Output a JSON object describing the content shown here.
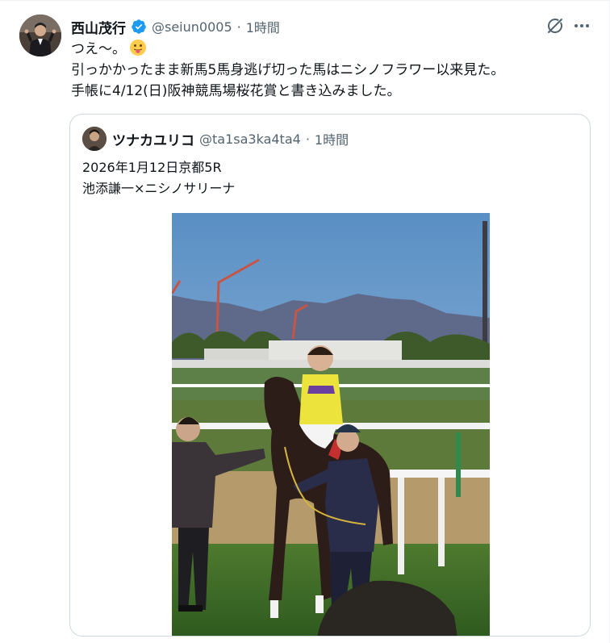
{
  "tweet": {
    "author_name": "西山茂行",
    "handle": "@seiun0005",
    "separator": "·",
    "time": "1時間",
    "lines": [
      "つえ〜。",
      "引っかかったまま新馬5馬身逃げ切った馬はニシノフラワー以来見た。",
      "手帳に4/12(日)阪神競馬場桜花賞と書き込みました。"
    ],
    "icons": {
      "verified": "verified-badge-icon",
      "grok": "grok-icon",
      "more": "more-options-icon",
      "emoji": "tongue-out-emoji-icon"
    },
    "colors": {
      "verified": "#1d9bf0",
      "secondary_text": "#536471"
    }
  },
  "quote": {
    "author_name": "ツナカユリコ",
    "handle": "@ta1sa3ka4ta4",
    "separator": "·",
    "time": "1時間",
    "lines": [
      "2026年1月12日京都5R",
      "池添謙一×ニシノサリーナ"
    ]
  }
}
